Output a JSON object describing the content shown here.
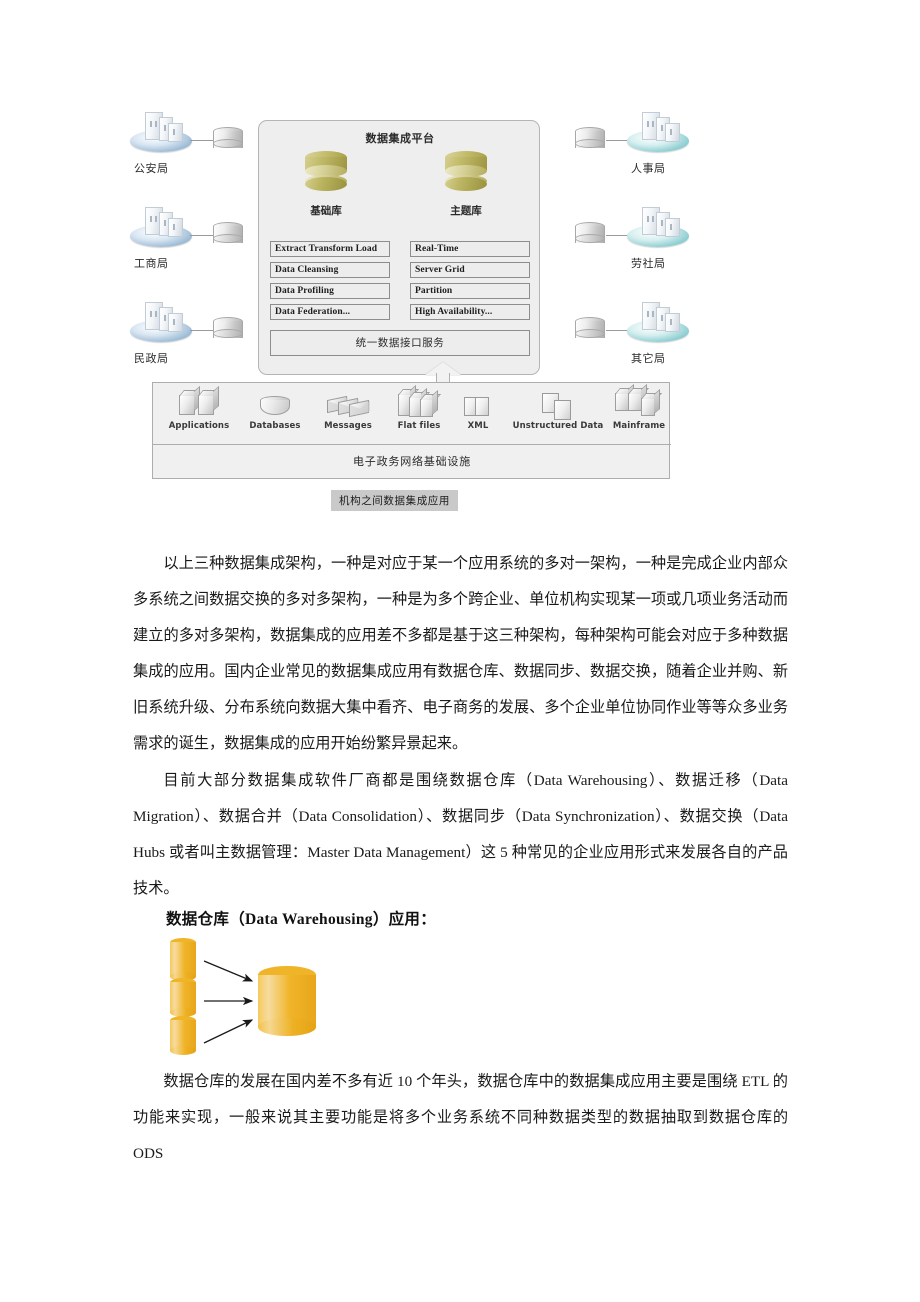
{
  "figure1": {
    "caption": "机构之间数据集成应用",
    "platform": {
      "title": "数据集成平台",
      "databases": [
        {
          "label": "基础库"
        },
        {
          "label": "主题库"
        }
      ],
      "features_left": [
        "Extract Transform Load",
        "Data Cleansing",
        "Data Profiling",
        "Data Federation..."
      ],
      "features_right": [
        "Real-Time",
        "Server Grid",
        "Partition",
        "High Availability..."
      ],
      "unified_service": "统一数据接口服务"
    },
    "agencies_left": [
      {
        "label": "公安局"
      },
      {
        "label": "工商局"
      },
      {
        "label": "民政局"
      }
    ],
    "agencies_right": [
      {
        "label": "人事局"
      },
      {
        "label": "劳社局"
      },
      {
        "label": "其它局"
      }
    ],
    "infrastructure": {
      "sources": [
        {
          "label": "Applications",
          "icon": "server-boxes-icon"
        },
        {
          "label": "Databases",
          "icon": "database-cylinder-icon"
        },
        {
          "label": "Messages",
          "icon": "message-envelopes-icon"
        },
        {
          "label": "Flat files",
          "icon": "stacked-files-icon"
        },
        {
          "label": "XML",
          "icon": "xml-pages-icon"
        },
        {
          "label": "Unstructured Data",
          "icon": "documents-icon"
        },
        {
          "label": "Mainframe",
          "icon": "mainframe-boxes-icon"
        }
      ],
      "network_label": "电子政务网络基础设施"
    },
    "colors": {
      "panel_fill": "#eeeeee",
      "panel_border": "#b5b5b5",
      "db_olive": "#b3ab5c",
      "agency_left_disc": "#9fbdd6",
      "agency_right_disc": "#8fcfd3",
      "caption_bg": "#c9c9c9"
    }
  },
  "body": {
    "paragraph_1": "以上三种数据集成架构，一种是对应于某一个应用系统的多对一架构，一种是完成企业内部众多系统之间数据交换的多对多架构，一种是为多个跨企业、单位机构实现某一项或几项业务活动而建立的多对多架构，数据集成的应用差不多都是基于这三种架构，每种架构可能会对应于多种数据集成的应用。国内企业常见的数据集成应用有数据仓库、数据同步、数据交换，随着企业并购、新旧系统升级、分布系统向数据大集中看齐、电子商务的发展、多个企业单位协同作业等等众多业务需求的诞生，数据集成的应用开始纷繁异景起来。",
    "paragraph_2": "目前大部分数据集成软件厂商都是围绕数据仓库（Data Warehousing）、数据迁移（Data Migration）、数据合并（Data Consolidation）、数据同步（Data Synchronization）、数据交换（Data Hubs 或者叫主数据管理：Master Data Management）这 5 种常见的企业应用形式来发展各自的产品技术。",
    "sub_heading": "数据仓库（Data Warehousing）应用：",
    "paragraph_3": "数据仓库的发展在国内差不多有近 10 个年头，数据仓库中的数据集成应用主要是围绕 ETL 的功能来实现，一般来说其主要功能是将多个业务系统不同种数据类型的数据抽取到数据仓库的 ODS"
  },
  "figure2": {
    "source_count": 3,
    "target_label": "",
    "arrow_count": 3,
    "colors": {
      "cylinder": "#f0b429",
      "arrow": "#1a1a1a"
    }
  }
}
